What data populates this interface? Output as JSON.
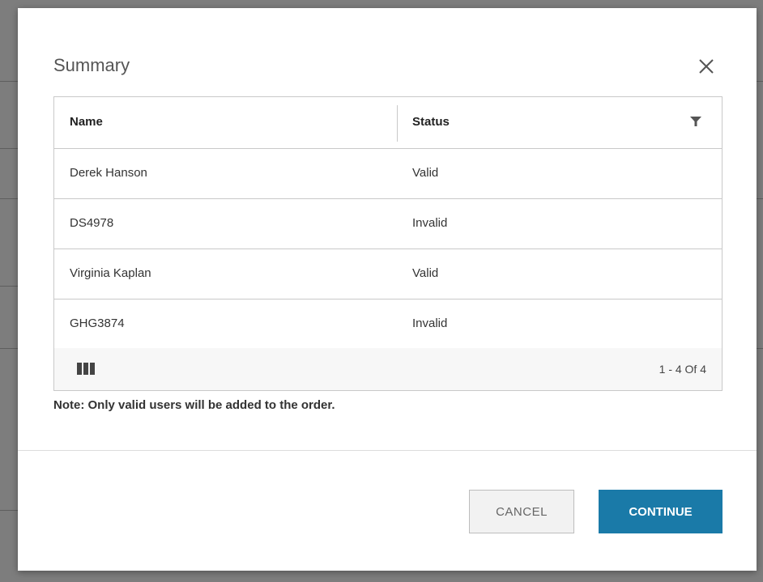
{
  "dialog": {
    "title": "Summary"
  },
  "grid": {
    "columns": [
      "Name",
      "Status"
    ],
    "rows": [
      {
        "name": "Derek Hanson",
        "status": "Valid"
      },
      {
        "name": "DS4978",
        "status": "Invalid"
      },
      {
        "name": "Virginia Kaplan",
        "status": "Valid"
      },
      {
        "name": "GHG3874",
        "status": "Invalid"
      }
    ],
    "pager": "1 - 4 Of 4"
  },
  "note": "Note: Only valid users will be added to the order.",
  "buttons": {
    "cancel": "CANCEL",
    "continue": "CONTINUE"
  },
  "icons": {
    "close": "close-icon",
    "filter": "filter-icon",
    "columns": "columns-icon"
  },
  "colors": {
    "primary": "#1a7aa8",
    "overlay": "#7d7d7d"
  }
}
